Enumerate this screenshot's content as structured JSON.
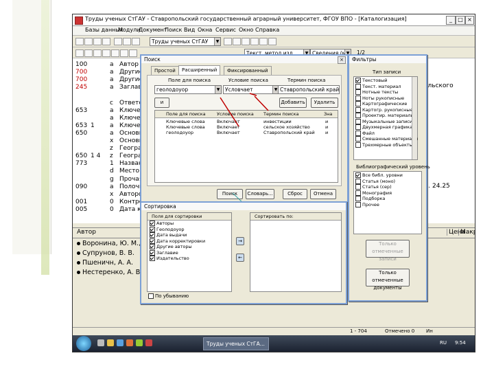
{
  "window": {
    "title": "Труды ученых СтГАУ - Ставропольский государственный аграрный университет, ФГОУ ВПО - [Каталогизация]"
  },
  "menu": [
    "Базы данных",
    "Модули",
    "Документ",
    "Поиск",
    "Вид",
    "Окна",
    "Сервис",
    "Окно",
    "Справка"
  ],
  "toolbar": {
    "db_combo": "Труды ученых СтГАУ",
    "template_combo": "Текст, метод.изд.",
    "view_combo": "Сведения (мои)",
    "counter_label": "1/2"
  },
  "records": [
    {
      "tag": "100",
      "ind": "",
      "sub": "a",
      "val": "Автор",
      "red": false
    },
    {
      "tag": "700",
      "ind": "",
      "sub": "a",
      "val": "Другие",
      "red": true
    },
    {
      "tag": "700",
      "ind": "",
      "sub": "a",
      "val": "Другие",
      "red": true
    },
    {
      "tag": "245",
      "ind": "",
      "sub": "a",
      "val": "Заглав",
      "red": true
    },
    {
      "tag": "",
      "ind": "",
      "sub": "",
      "val": "",
      "red": false
    },
    {
      "tag": "",
      "ind": "",
      "sub": "c",
      "val": "Ответс",
      "red": false
    },
    {
      "tag": "653",
      "ind": "",
      "sub": "a",
      "val": "Ключев",
      "red": false
    },
    {
      "tag": "",
      "ind": "",
      "sub": "a",
      "val": "Ключев",
      "red": false
    },
    {
      "tag": "653",
      "ind": "1",
      "sub": "a",
      "val": "Ключев",
      "red": false
    },
    {
      "tag": "650",
      "ind": "",
      "sub": "a",
      "val": "Основн",
      "red": false
    },
    {
      "tag": "",
      "ind": "",
      "sub": "x",
      "val": "Основн",
      "red": false
    },
    {
      "tag": "",
      "ind": "",
      "sub": "z",
      "val": "Геогра",
      "red": false
    },
    {
      "tag": "650",
      "ind": "1 4",
      "sub": "z",
      "val": "Геогра",
      "red": false
    },
    {
      "tag": "773",
      "ind": "",
      "sub": "1",
      "val": "Назван",
      "red": false
    },
    {
      "tag": "",
      "ind": "",
      "sub": "d",
      "val": "Место",
      "red": false
    },
    {
      "tag": "",
      "ind": "",
      "sub": "g",
      "val": "Прочая",
      "red": false
    },
    {
      "tag": "090",
      "ind": "",
      "sub": "a",
      "val": "Полочн",
      "red": false
    },
    {
      "tag": "",
      "ind": "",
      "sub": "x",
      "val": "Авторс",
      "red": false
    },
    {
      "tag": "001",
      "ind": "",
      "sub": "0",
      "val": "Контро",
      "red": false
    },
    {
      "tag": "005",
      "ind": "",
      "sub": "0",
      "val": "Дата ко",
      "red": false
    }
  ],
  "records_right": {
    "title_tail": "ольского",
    "pages_tail": "С. 24.25"
  },
  "author_table": {
    "headers": [
      "Автор",
      "Цена",
      "Макро"
    ],
    "rows": [
      "Воронина, Ю. М., Си",
      "Супрунов, В. В.",
      "Пшеничн, А. А.",
      "Нестеренко, А. В., Ко"
    ]
  },
  "status": {
    "range": "1 - 704",
    "selected": "Отмечено 0",
    "page": "Ин"
  },
  "taskbar": {
    "app_button": "Труды ученых СтГА...",
    "lang": "RU",
    "time": "9:54"
  },
  "search_dialog": {
    "title": "Поиск",
    "tabs": [
      "Простой",
      "Расширенный",
      "Фиксированный"
    ],
    "col_field": "Поле для поиска",
    "col_cond": "Условие поиска",
    "col_term": "Термин поиска",
    "field_value": "геолодоуор",
    "cond_value": "Условчает",
    "term_value": "Ставропольский край",
    "btn_and": "и",
    "btn_add": "Добавить",
    "btn_delete": "Удалить",
    "grid_headers": [
      "Поле для поиска",
      "Условие поиска",
      "Термин поиска",
      "Зна"
    ],
    "grid_rows": [
      [
        "Ключевые слова",
        "Включает",
        "инвестиции",
        "и"
      ],
      [
        "Ключевые слова",
        "Включает",
        "сельское хозяйство",
        "и"
      ],
      [
        "геолодоуор",
        "Включает",
        "Ставропольский край",
        "и"
      ]
    ],
    "btn_search": "Поиск",
    "btn_dict": "Словарь...",
    "btn_reset": "Сброс",
    "btn_cancel": "Отмена"
  },
  "sort_dialog": {
    "title": "Сортировка",
    "col_fields": "Поля для сортировки",
    "col_sortby": "Сортировать по:",
    "items": [
      "Авторы",
      "Геолодоуор",
      "Дата выдачи",
      "Дата корректировки",
      "Другие авторы",
      "Заглавие",
      "Издательство"
    ],
    "descending": "По убыванию"
  },
  "filter_dialog": {
    "title": "Фильтры",
    "type_label": "Тип записи",
    "types": [
      {
        "label": "Текстовый",
        "on": true
      },
      {
        "label": "Текст. материал",
        "on": false
      },
      {
        "label": "Нотные тексты",
        "on": false
      },
      {
        "label": "Ноты рукописные",
        "on": false
      },
      {
        "label": "Картографические",
        "on": false
      },
      {
        "label": "Картогр. рукописные",
        "on": false
      },
      {
        "label": "Проектир. материалы",
        "on": false
      },
      {
        "label": "Музыкальные записи",
        "on": false
      },
      {
        "label": "Двухмерная графика",
        "on": false
      },
      {
        "label": "Файл",
        "on": false
      },
      {
        "label": "Смешанные материалы",
        "on": false
      },
      {
        "label": "Трехмерные объекты",
        "on": false
      }
    ],
    "biblio_label": "Библиографический уровень",
    "levels": [
      {
        "label": "Все библ. уровни",
        "on": true
      },
      {
        "label": "Статья (моно)",
        "on": false
      },
      {
        "label": "Статья (сер)",
        "on": false
      },
      {
        "label": "Монография",
        "on": false
      },
      {
        "label": "Подборка",
        "on": false
      },
      {
        "label": "Прочее",
        "on": false
      }
    ],
    "btn_all": "Только отмеченные записи",
    "btn_marked": "Только отмеченные документы"
  },
  "colors": {
    "red": "#c00000",
    "accent": "#7ca0d6"
  }
}
